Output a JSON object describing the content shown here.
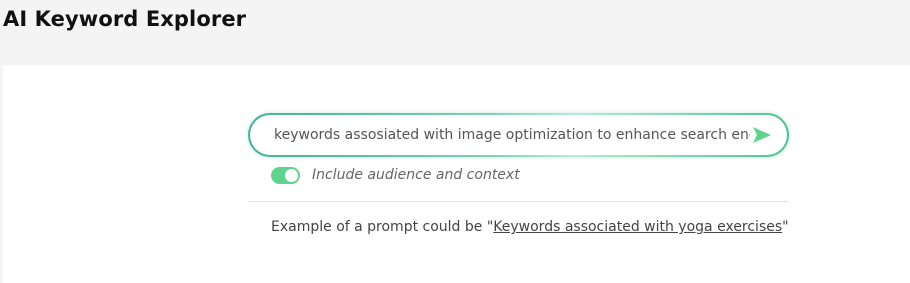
{
  "header": {
    "title": "AI Keyword Explorer"
  },
  "search": {
    "value": "keywords assosiated with image optimization to enhance search engine",
    "send_icon": "send-arrow-icon",
    "accent_color": "#5fd48c"
  },
  "options": {
    "toggle_label": "Include audience and context",
    "toggle_on": true
  },
  "example": {
    "prefix": "Example of a prompt could be \"",
    "link_text": "Keywords associated with yoga exercises",
    "suffix": "\""
  }
}
